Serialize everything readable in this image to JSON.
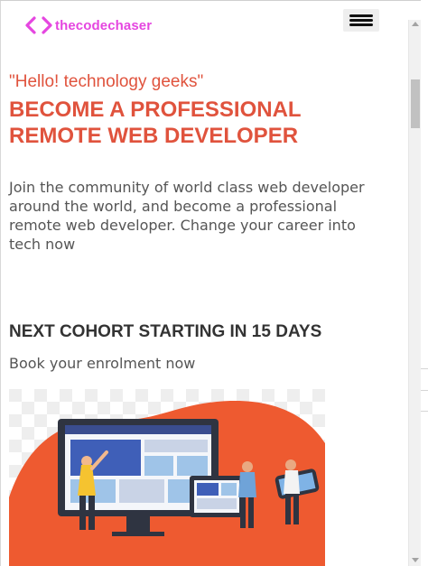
{
  "header": {
    "logo_text": "thecodechaser",
    "logo_icon": "code-brackets-icon",
    "menu_icon": "hamburger-menu-icon"
  },
  "hero": {
    "greeting": "\"Hello! technology geeks\"",
    "headline": "BECOME A PROFESSIONAL REMOTE WEB DEVELOPER",
    "intro": "Join the community of world class web developer around the world, and become a professional remote web developer. Change your career into tech now"
  },
  "cohort": {
    "title": "NEXT COHORT STARTING IN 15 DAYS",
    "subtitle": "Book your enrolment now"
  },
  "illustration": {
    "name": "remote-developers-illustration"
  },
  "colors": {
    "accent": "#e0533d",
    "logo": "#e546e0",
    "text": "#555555",
    "heading": "#333333"
  }
}
